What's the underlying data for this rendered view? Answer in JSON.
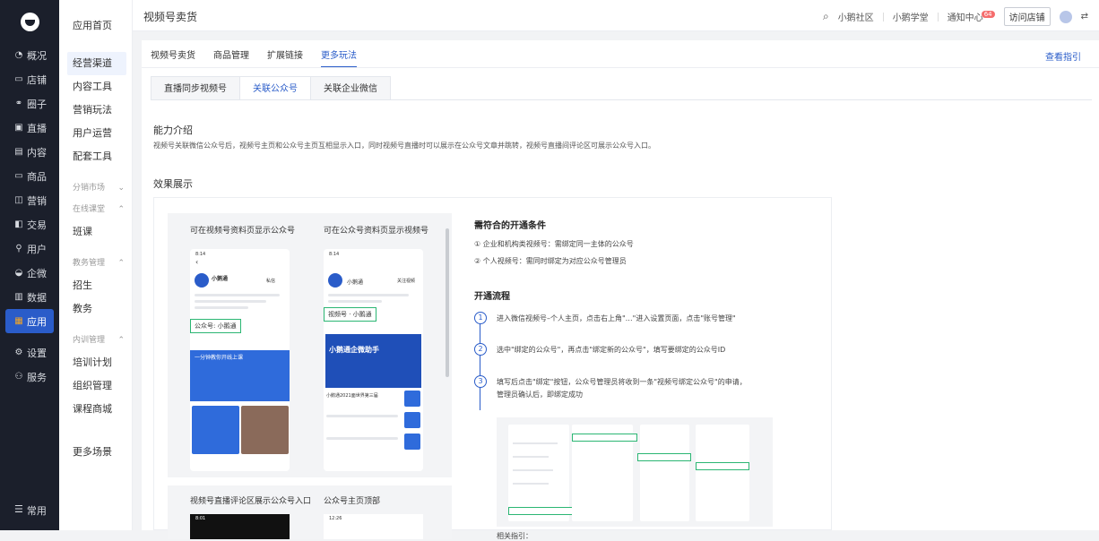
{
  "sidebar": {
    "items": [
      {
        "icon": "◔",
        "label": "概况"
      },
      {
        "icon": "▭",
        "label": "店铺"
      },
      {
        "icon": "⚭",
        "label": "圈子"
      },
      {
        "icon": "▣",
        "label": "直播"
      },
      {
        "icon": "▤",
        "label": "内容"
      },
      {
        "icon": "▭",
        "label": "商品"
      },
      {
        "icon": "◫",
        "label": "营销"
      },
      {
        "icon": "◧",
        "label": "交易"
      },
      {
        "icon": "⚲",
        "label": "用户"
      },
      {
        "icon": "◒",
        "label": "企微"
      },
      {
        "icon": "▥",
        "label": "数据"
      },
      {
        "icon": "▦",
        "label": "应用"
      },
      {
        "icon": "⚙",
        "label": "设置"
      },
      {
        "icon": "⚇",
        "label": "服务"
      }
    ],
    "bottom": {
      "icon": "☰",
      "label": "常用"
    }
  },
  "subnav": {
    "home": "应用首页",
    "items": [
      "经营渠道",
      "内容工具",
      "营销玩法",
      "用户运营",
      "配套工具"
    ],
    "group1": {
      "title": "分销市场",
      "arrow": "⌄"
    },
    "group2": {
      "title": "在线课堂",
      "arrow": "⌃",
      "items": [
        "班课"
      ]
    },
    "group3": {
      "title": "教务管理",
      "arrow": "⌃",
      "items": [
        "招生",
        "教务"
      ]
    },
    "group4": {
      "title": "内训管理",
      "arrow": "⌃",
      "items": [
        "培训计划",
        "组织管理",
        "课程商城"
      ]
    },
    "more": "更多场景"
  },
  "topbar": {
    "title": "视频号卖货",
    "search_icon": "⌕",
    "links": [
      "小鹅社区",
      "小鹅学堂"
    ],
    "notice": "通知中心",
    "notice_count": "64",
    "visit": "访问店铺",
    "more_icon": "⇄"
  },
  "tabs1": [
    "视频号卖货",
    "商品管理",
    "扩展链接",
    "更多玩法"
  ],
  "guide_link": "查看指引",
  "tabs2": [
    "直播同步视频号",
    "关联公众号",
    "关联企业微信"
  ],
  "intro": {
    "title": "能力介绍",
    "text": "视频号关联微信公众号后，视频号主页和公众号主页互相显示入口，同时视频号直播时可以展示在公众号文章并跳转，视频号直播间评论区可展示公众号入口。"
  },
  "effect_title": "效果展示",
  "demo": {
    "cap1": "可在视频号资料页显示公众号",
    "cap2": "可在公众号资料页显示视频号",
    "cap3": "视频号直播评论区展示公众号入口",
    "cap4": "公众号主页顶部",
    "phone1": {
      "time": "8:14",
      "name": "小鹅通",
      "follow": "私信",
      "tag": "公众号: 小鹅通",
      "banner": "一分钟教你开线上课",
      "arrow": "‹"
    },
    "phone2": {
      "time": "8:14",
      "name": "小鹅通",
      "follow": "关注视频",
      "tag": "视频号 · 小鹅通",
      "banner": "小鹅通企微助手",
      "sub_banner": "小鹅通2021面世界第三届"
    },
    "phone3": {
      "time": "8:01"
    },
    "phone4": {
      "time": "12:26"
    }
  },
  "steps": {
    "cond_title": "需符合的开通条件",
    "cond1": "① 企业和机构类视频号：需绑定同一主体的公众号",
    "cond2": "② 个人视频号：需同时绑定为对应公众号管理员",
    "flow_title": "开通流程",
    "flow": [
      {
        "num": "1",
        "text": "进入微信视频号–个人主页，点击右上角\"…\"进入设置页面，点击\"账号管理\""
      },
      {
        "num": "2",
        "text": "选中\"绑定的公众号\"，再点击\"绑定新的公众号\"，填写要绑定的公众号ID"
      },
      {
        "num": "3",
        "text": "填写后点击\"绑定\"按钮，公众号管理员将收到一条\"视频号绑定公众号\"的申请，",
        "text2": "管理员确认后，即绑定成功"
      }
    ],
    "related": "相关指引："
  }
}
